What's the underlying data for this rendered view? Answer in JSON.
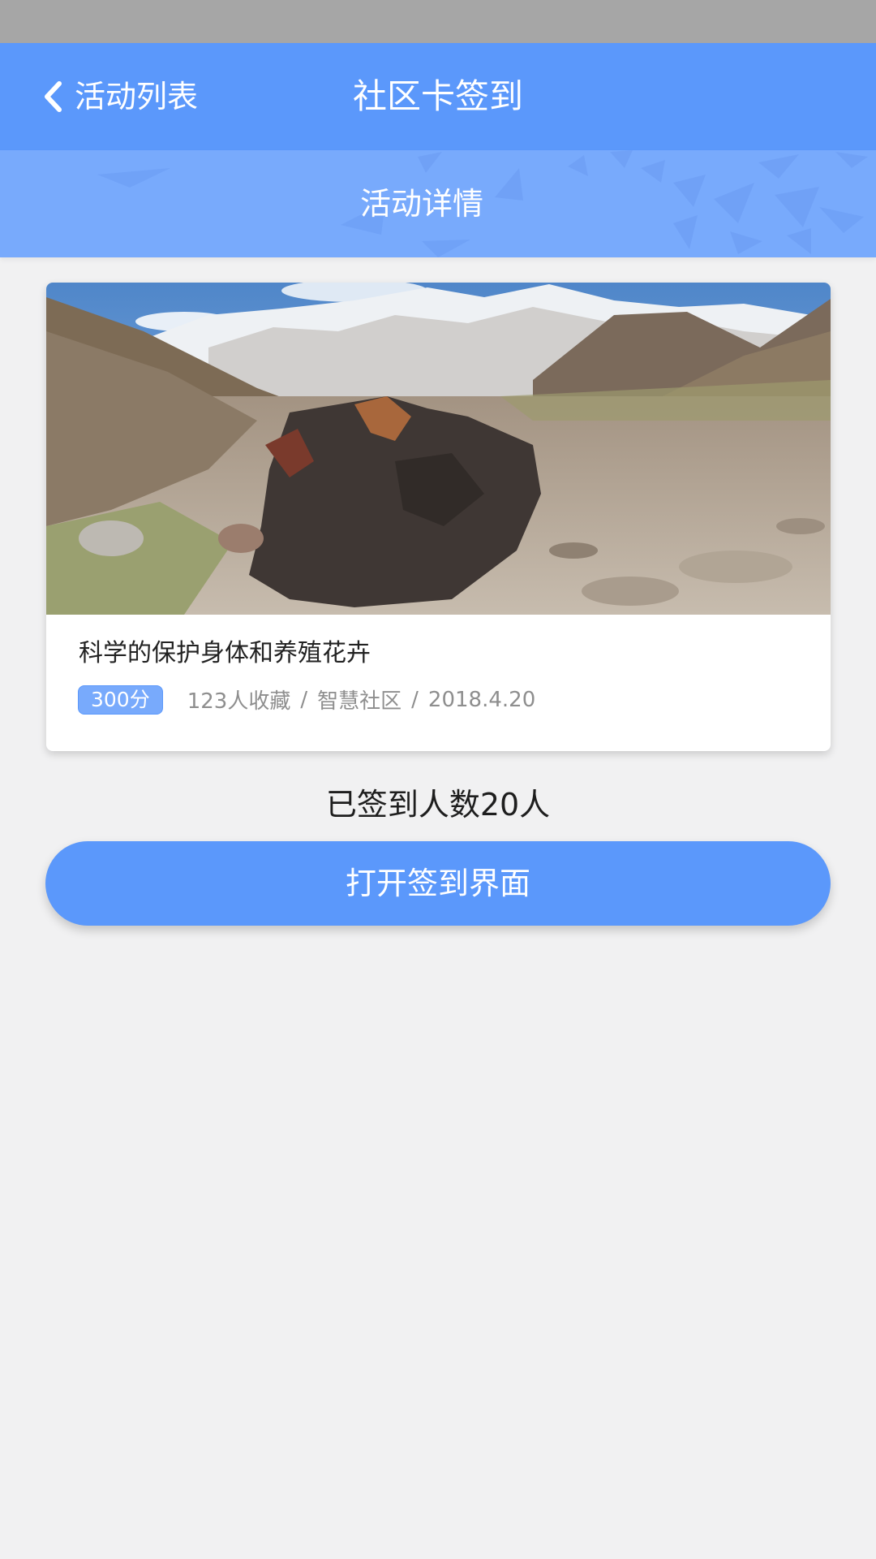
{
  "nav": {
    "back_label": "活动列表",
    "title": "社区卡签到"
  },
  "sub_header": {
    "title": "活动详情"
  },
  "activity": {
    "title": "科学的保护身体和养殖花卉",
    "points": "300分",
    "favorites": "123人收藏",
    "community": "智慧社区",
    "date": "2018.4.20",
    "separator": "/"
  },
  "signed_count": "已签到人数20人",
  "open_button_label": "打开签到界面",
  "colors": {
    "primary": "#5b98fb",
    "sub_header": "#78aafc",
    "status_bar": "#a6a6a6",
    "background": "#f1f1f2"
  }
}
